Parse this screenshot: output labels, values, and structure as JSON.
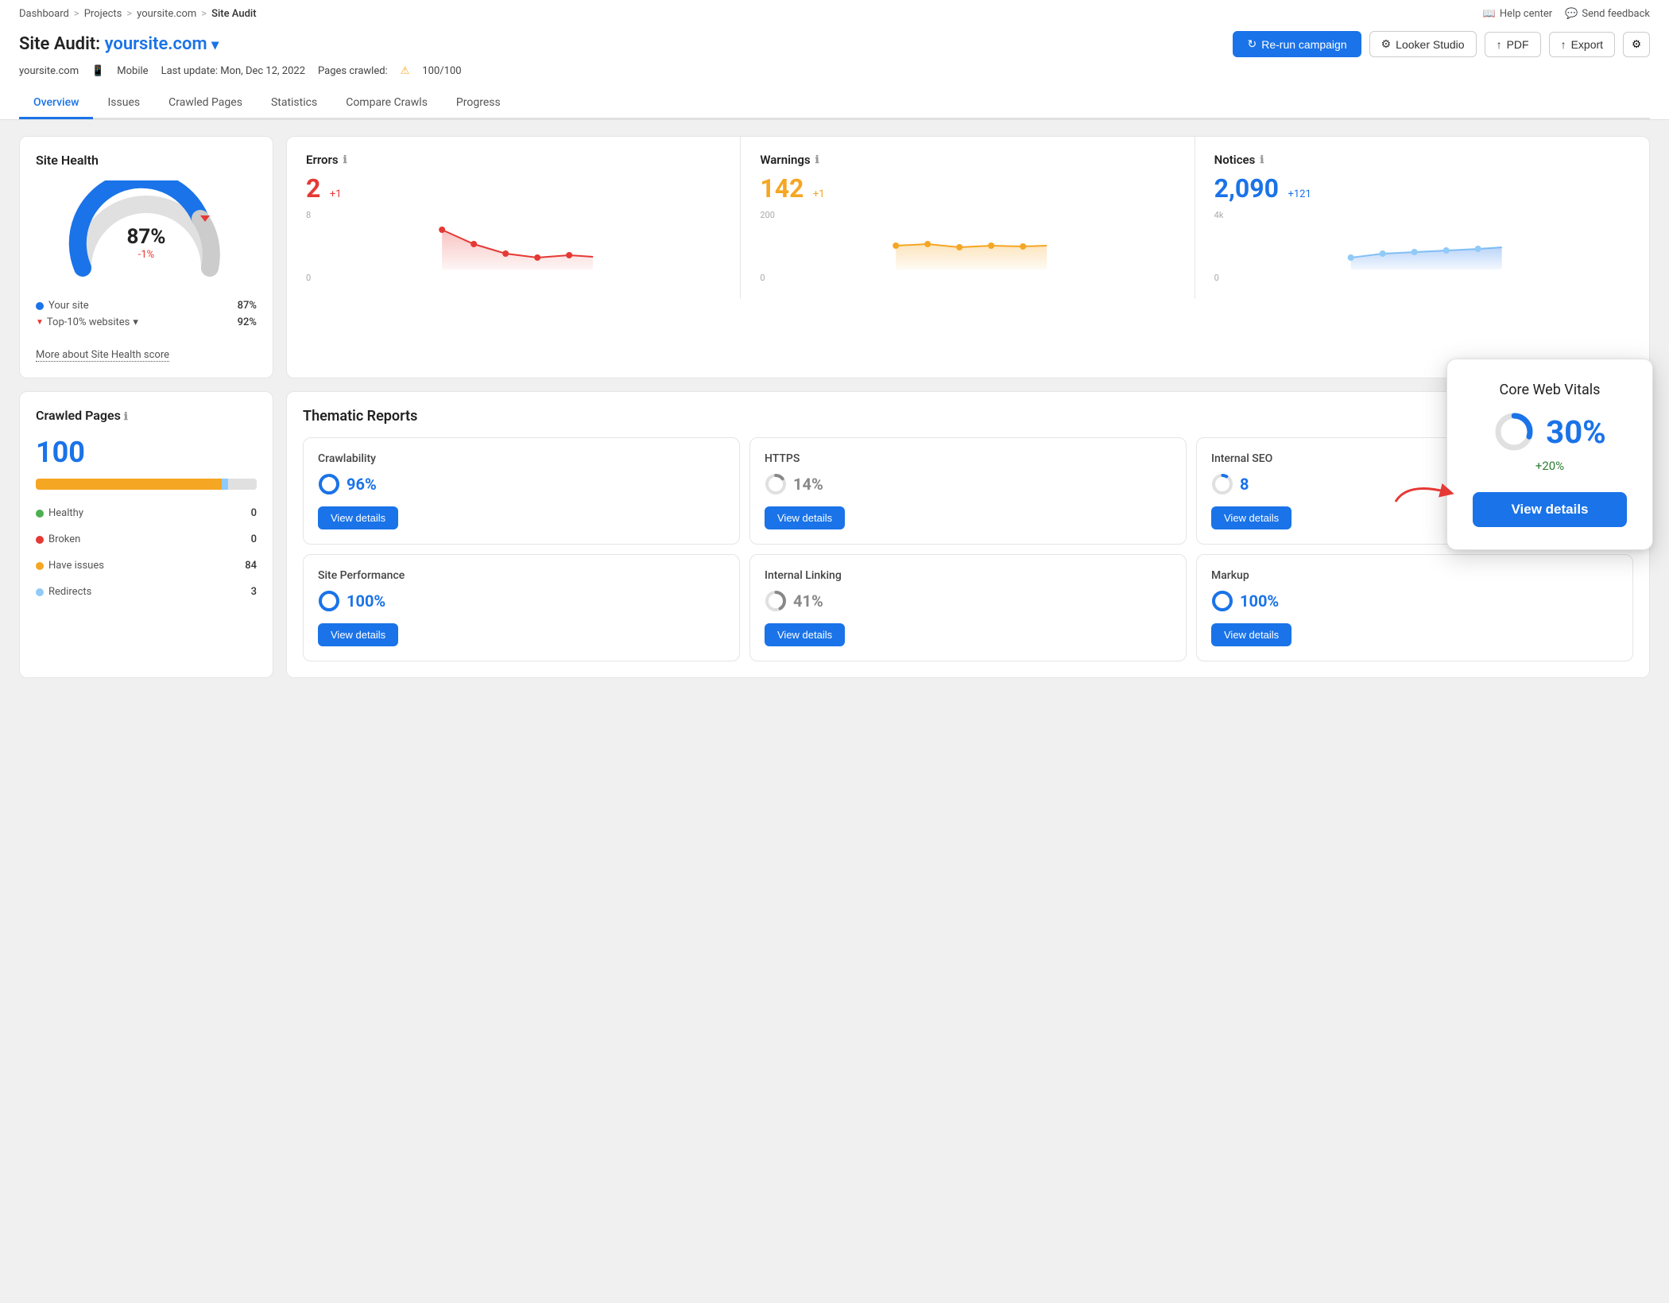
{
  "breadcrumb": {
    "items": [
      "Dashboard",
      "Projects",
      "yoursite.com",
      "Site Audit"
    ],
    "separators": [
      ">",
      ">",
      ">"
    ]
  },
  "top_actions": {
    "help_center": "Help center",
    "send_feedback": "Send feedback"
  },
  "page_title": {
    "prefix": "Site Audit: ",
    "site": "yoursite.com",
    "dropdown_arrow": "▾"
  },
  "buttons": {
    "rerun": "Re-run campaign",
    "looker": "Looker Studio",
    "pdf": "PDF",
    "export": "Export"
  },
  "meta": {
    "site": "yoursite.com",
    "device": "Mobile",
    "last_update": "Last update: Mon, Dec 12, 2022",
    "pages_crawled": "Pages crawled:",
    "pages_value": "100/100"
  },
  "tabs": [
    "Overview",
    "Issues",
    "Crawled Pages",
    "Statistics",
    "Compare Crawls",
    "Progress"
  ],
  "active_tab": "Overview",
  "site_health": {
    "title": "Site Health",
    "percent": "87%",
    "change": "-1%",
    "your_site_label": "Your site",
    "your_site_value": "87%",
    "top10_label": "Top-10% websites",
    "top10_value": "92%",
    "more_link": "More about Site Health score",
    "your_site_color": "#1a73e8",
    "top10_color": "#e53935"
  },
  "errors": {
    "label": "Errors",
    "value": "2",
    "change": "+1",
    "chart_high": "8",
    "chart_low": "0"
  },
  "warnings": {
    "label": "Warnings",
    "value": "142",
    "change": "+1",
    "chart_high": "200",
    "chart_low": "0"
  },
  "notices": {
    "label": "Notices",
    "value": "2,090",
    "change": "+121",
    "chart_high": "4k",
    "chart_low": "0"
  },
  "crawled_pages": {
    "title": "Crawled Pages",
    "value": "100",
    "healthy_label": "Healthy",
    "healthy_value": "0",
    "healthy_color": "#4caf50",
    "broken_label": "Broken",
    "broken_value": "0",
    "broken_color": "#e53935",
    "issues_label": "Have issues",
    "issues_value": "84",
    "issues_color": "#f5a623",
    "redirects_label": "Redirects",
    "redirects_value": "3",
    "redirects_color": "#90caf9"
  },
  "thematic": {
    "section_title": "Thematic Reports",
    "items": [
      {
        "name": "Crawlability",
        "score": "96%",
        "score_color": "#1a73e8",
        "donut_fill": 96,
        "btn": "View details"
      },
      {
        "name": "HTTPS",
        "score": "14%",
        "score_color": "#888",
        "donut_fill": 14,
        "btn": "View details"
      },
      {
        "name": "Internal SEO",
        "score": "8",
        "score_color": "#1a73e8",
        "donut_fill": 8,
        "btn": "View details"
      },
      {
        "name": "Site Performance",
        "score": "100%",
        "score_color": "#1a73e8",
        "donut_fill": 100,
        "btn": "View details"
      },
      {
        "name": "Internal Linking",
        "score": "41%",
        "score_color": "#888",
        "donut_fill": 41,
        "btn": "View details"
      },
      {
        "name": "Markup",
        "score": "100%",
        "score_color": "#1a73e8",
        "donut_fill": 100,
        "btn": "View details"
      }
    ]
  },
  "cwv_popup": {
    "title": "Core Web Vitals",
    "percent": "30%",
    "change": "+20%",
    "donut_fill": 30,
    "btn": "View details"
  }
}
